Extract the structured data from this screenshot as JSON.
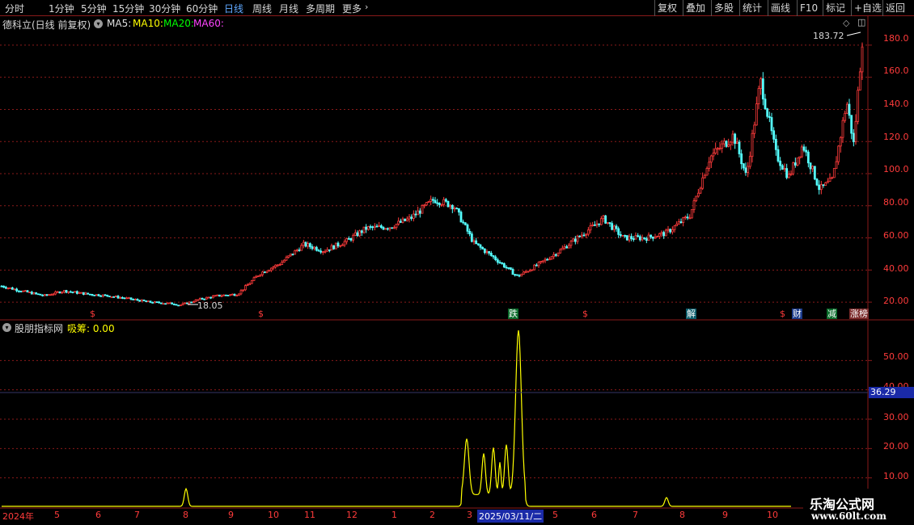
{
  "toolbar": {
    "periods": [
      "分时",
      "1分钟",
      "5分钟",
      "15分钟",
      "30分钟",
      "60分钟",
      "日线",
      "周线",
      "月线",
      "多周期",
      "更多"
    ],
    "active_period": "日线",
    "right_buttons": [
      "复权",
      "叠加",
      "多股",
      "统计",
      "画线",
      "F10",
      "+自选",
      "返回"
    ],
    "tag_label": "标记"
  },
  "main_panel": {
    "title": "德科立(日线 前复权)",
    "ma_labels": [
      "MA5:",
      "MA10:",
      "MA20:",
      "MA60:"
    ],
    "ma_colors": [
      "#ffffff",
      "#ffff00",
      "#00ff00",
      "#ff00ff"
    ],
    "high_label": "183.72",
    "low_label": "18.05",
    "y_ticks": [
      "180.0",
      "160.0",
      "140.0",
      "120.0",
      "100.0",
      "80.00",
      "60.00",
      "40.00",
      "20.00"
    ],
    "markers": [
      {
        "text": "$",
        "bg": "#000000",
        "color": "#ff3b3b"
      },
      {
        "text": "$",
        "bg": "#000000",
        "color": "#ff3b3b"
      },
      {
        "text": "跌",
        "bg": "#0a6b2a",
        "color": "#ffffff"
      },
      {
        "text": "$",
        "bg": "#000000",
        "color": "#ff3b3b"
      },
      {
        "text": "解",
        "bg": "#0a5d6b",
        "color": "#ffffff"
      },
      {
        "text": "$",
        "bg": "#000000",
        "color": "#ff3b3b"
      },
      {
        "text": "财",
        "bg": "#1a3a8a",
        "color": "#ffffff"
      },
      {
        "text": "减",
        "bg": "#0a6b2a",
        "color": "#ffffff"
      },
      {
        "text": "涨榜",
        "bg": "#7a2a2a",
        "color": "#ffffff"
      }
    ]
  },
  "indicator_panel": {
    "title": "股朋指标网",
    "series_label": "吸筹: 0.00",
    "y_ticks": [
      "50.00",
      "40.00",
      "30.00",
      "20.00",
      "10.00"
    ],
    "crosshair_value": "36.29"
  },
  "date_axis": {
    "ticks": [
      "2024年",
      "5",
      "6",
      "7",
      "8",
      "9",
      "10",
      "11",
      "12",
      "1",
      "2",
      "3",
      "5",
      "6",
      "7",
      "8",
      "9",
      "10"
    ],
    "highlight": "2025/03/11/二"
  },
  "watermark": {
    "line1": "乐淘公式网",
    "line2": "www.60lt.com"
  },
  "colors": {
    "up": "#ff3b3b",
    "down": "#54ffff",
    "grid": "#8a1a1a",
    "indicator": "#ffff00",
    "crosshair_bg": "#1a2aa8"
  },
  "chart_data": [
    {
      "type": "candlestick",
      "title": "德科立(日线 前复权)",
      "y_axis_ticks": [
        20,
        40,
        60,
        80,
        100,
        120,
        140,
        160,
        180
      ],
      "ylim": [
        12,
        190
      ],
      "close_path": [
        [
          "2024-04-01",
          30
        ],
        [
          "2024-04-15",
          27
        ],
        [
          "2024-05-01",
          24
        ],
        [
          "2024-05-15",
          27
        ],
        [
          "2024-06-01",
          25
        ],
        [
          "2024-06-15",
          24
        ],
        [
          "2024-07-01",
          22
        ],
        [
          "2024-07-15",
          20
        ],
        [
          "2024-08-01",
          19
        ],
        [
          "2024-08-05",
          18.05
        ],
        [
          "2024-08-20",
          22
        ],
        [
          "2024-09-01",
          24
        ],
        [
          "2024-09-15",
          25
        ],
        [
          "2024-10-01",
          38
        ],
        [
          "2024-10-15",
          44
        ],
        [
          "2024-11-01",
          56
        ],
        [
          "2024-11-15",
          52
        ],
        [
          "2024-12-01",
          58
        ],
        [
          "2024-12-15",
          66
        ],
        [
          "2025-01-01",
          67
        ],
        [
          "2025-01-15",
          72
        ],
        [
          "2025-02-01",
          84
        ],
        [
          "2025-02-15",
          80
        ],
        [
          "2025-03-01",
          57
        ],
        [
          "2025-03-15",
          48
        ],
        [
          "2025-04-01",
          36
        ],
        [
          "2025-04-15",
          43
        ],
        [
          "2025-05-01",
          52
        ],
        [
          "2025-05-15",
          61
        ],
        [
          "2025-06-01",
          72
        ],
        [
          "2025-06-15",
          60
        ],
        [
          "2025-07-01",
          60
        ],
        [
          "2025-07-15",
          63
        ],
        [
          "2025-08-01",
          74
        ],
        [
          "2025-08-15",
          110
        ],
        [
          "2025-09-01",
          124
        ],
        [
          "2025-09-10",
          98
        ],
        [
          "2025-09-20",
          158
        ],
        [
          "2025-10-01",
          112
        ],
        [
          "2025-10-10",
          98
        ],
        [
          "2025-10-20",
          118
        ],
        [
          "2025-11-01",
          90
        ],
        [
          "2025-11-10",
          96
        ],
        [
          "2025-11-20",
          145
        ],
        [
          "2025-11-25",
          118
        ],
        [
          "2025-12-01",
          183.72
        ]
      ]
    },
    {
      "type": "line",
      "series": [
        {
          "name": "吸筹",
          "values": [
            [
              0,
              0
            ],
            [
              0.37,
              0
            ],
            [
              0.375,
              12
            ],
            [
              0.385,
              3
            ],
            [
              0.93,
              0.5
            ],
            [
              0.935,
              20
            ],
            [
              0.945,
              5
            ],
            [
              0.96,
              17
            ],
            [
              0.965,
              10
            ],
            [
              0.97,
              15
            ],
            [
              0.975,
              12
            ],
            [
              0.985,
              20
            ],
            [
              0.99,
              10
            ],
            [
              1.0,
              56
            ]
          ]
        }
      ],
      "y_axis_ticks": [
        10,
        20,
        30,
        40,
        50
      ],
      "ylim": [
        0,
        60
      ]
    }
  ]
}
